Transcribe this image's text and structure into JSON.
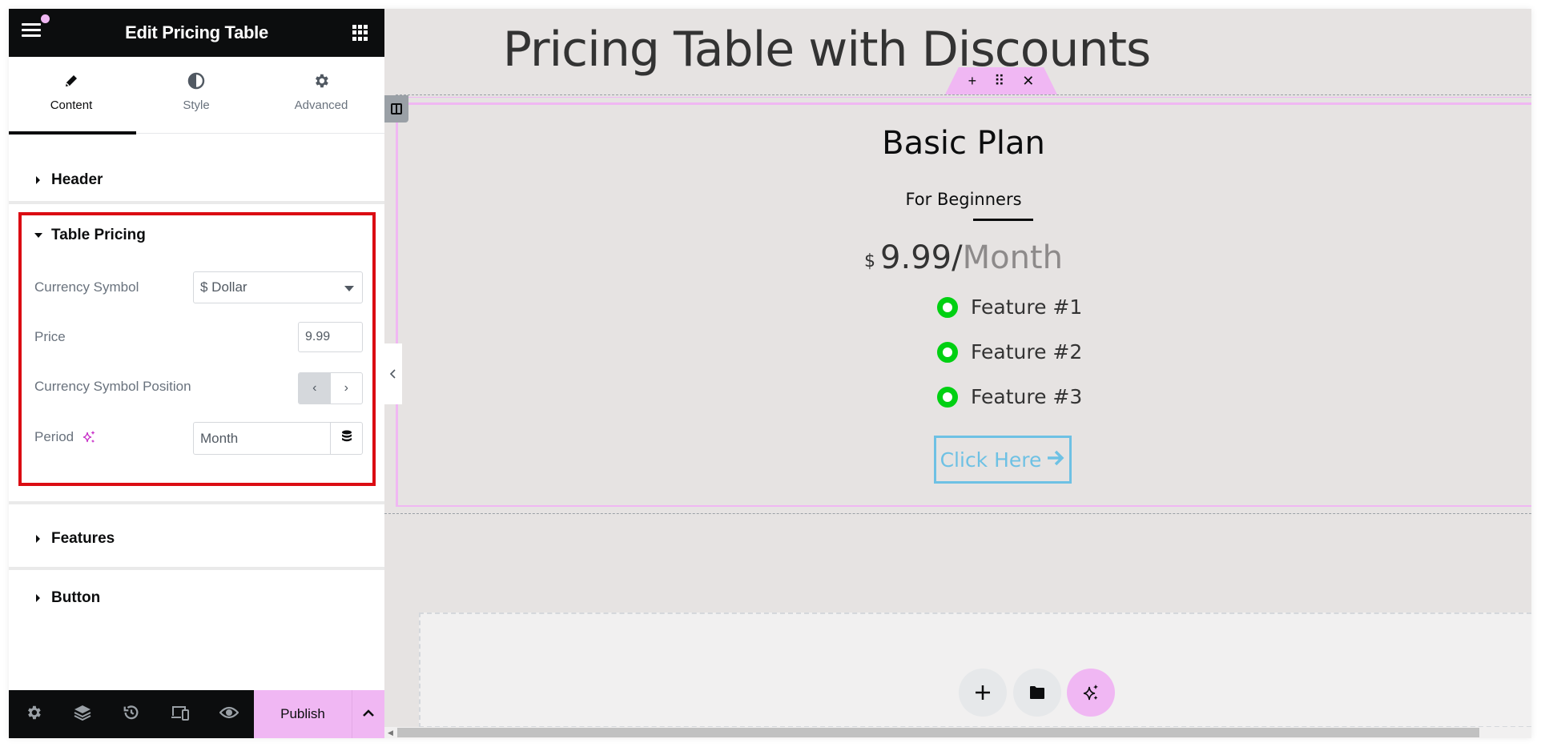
{
  "panel": {
    "title": "Edit Pricing Table",
    "tabs": [
      {
        "label": "Content",
        "icon": "pencil-icon",
        "active": true
      },
      {
        "label": "Style",
        "icon": "half-circle-icon",
        "active": false
      },
      {
        "label": "Advanced",
        "icon": "gear-icon",
        "active": false
      }
    ],
    "sections": {
      "header": "Header",
      "table_pricing": "Table Pricing",
      "features": "Features",
      "button": "Button"
    },
    "controls": {
      "currency_symbol_label": "Currency Symbol",
      "currency_symbol_value": "$ Dollar",
      "price_label": "Price",
      "price_value": "9.99",
      "currency_position_label": "Currency Symbol Position",
      "currency_position_options": [
        "‹",
        "›"
      ],
      "currency_position_selected": "left",
      "period_label": "Period",
      "period_value": "Month"
    },
    "footer": {
      "icons": [
        "settings-icon",
        "layers-icon",
        "history-icon",
        "responsive-icon",
        "preview-eye-icon"
      ],
      "publish_label": "Publish"
    }
  },
  "canvas": {
    "page_heading": "Pricing Table with Discounts",
    "section_handle": {
      "add": "+",
      "move": "⠿",
      "delete": "✕"
    },
    "pricing_table": {
      "title": "Basic Plan",
      "subtitle": "For Beginners",
      "currency": "$",
      "price": "9.99",
      "separator": "/",
      "period": "Month",
      "features": [
        "Feature #1",
        "Feature #2",
        "Feature #3"
      ],
      "button_label": "Click Here",
      "colors": {
        "feature_icon": "#00d012",
        "button": "#6ec1e4"
      }
    },
    "add_section_buttons": [
      "add-section-plus",
      "template-library-folder",
      "ai-sparkle"
    ]
  },
  "colors": {
    "accent_pink": "#f0b7f3",
    "highlight_red": "#db0c13",
    "panel_dark": "#0c0d0e",
    "canvas_bg": "#e6e3e2"
  }
}
